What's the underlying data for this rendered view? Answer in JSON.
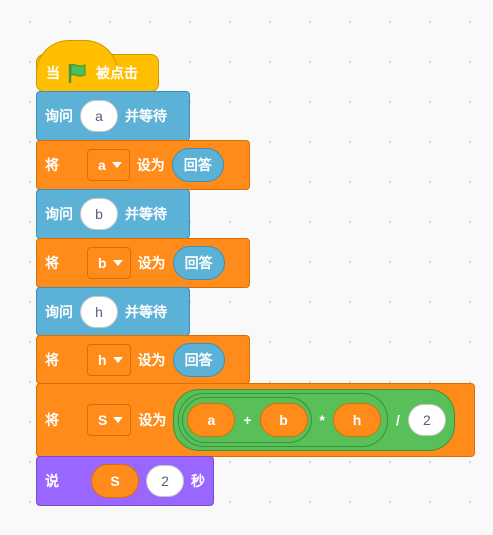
{
  "colors": {
    "events": "#ffbf00",
    "sensing": "#5cb1d6",
    "variables": "#ff8c1a",
    "operators": "#59c059",
    "looks": "#9966ff",
    "flag": "#4cbf56"
  },
  "hat": {
    "prefix": "当",
    "suffix": "被点击",
    "icon": "green-flag-icon"
  },
  "ask_label": "询问",
  "and_wait_label": "并等待",
  "set_label": "将",
  "to_label": "设为",
  "answer_label": "回答",
  "blocks": [
    {
      "type": "ask",
      "question": "a"
    },
    {
      "type": "set",
      "variable": "a"
    },
    {
      "type": "ask",
      "question": "b"
    },
    {
      "type": "set",
      "variable": "b"
    },
    {
      "type": "ask",
      "question": "h"
    },
    {
      "type": "set",
      "variable": "h"
    }
  ],
  "formula_set": {
    "variable": "S",
    "expression": {
      "op1_left": "a",
      "plus": "+",
      "op1_right": "b",
      "times": "*",
      "op2_right": "h",
      "divide": "/",
      "divisor": "2"
    }
  },
  "say": {
    "label": "说",
    "value": "S",
    "seconds": "2",
    "unit": "秒"
  }
}
